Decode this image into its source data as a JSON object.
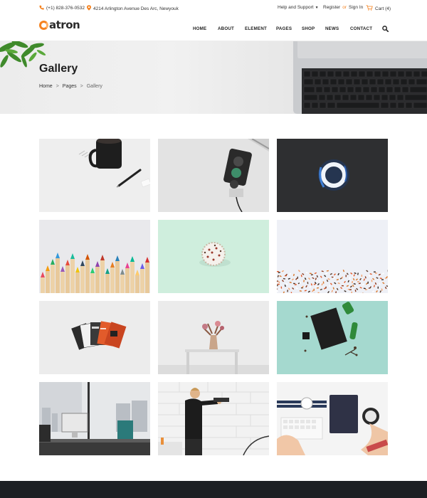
{
  "topbar": {
    "phone": "(+1) 828-376-0532",
    "address": "4214 Arlington Avenue Des Arc, Newyouk",
    "help": "Help and Support",
    "register": "Register",
    "or": "or",
    "signin": "Sign In",
    "cart": "Cart (4)"
  },
  "header": {
    "logo_text": "atron",
    "nav": [
      "HOME",
      "ABOUT",
      "ELEMENT",
      "PAGES",
      "SHOP",
      "NEWS",
      "CONTACT"
    ]
  },
  "banner": {
    "title": "Gallery",
    "breadcrumb": [
      "Home",
      "Pages",
      "Gallery"
    ],
    "separator": ">"
  },
  "gallery": {
    "tiles": [
      "mug-and-pen-tile",
      "traffic-light-tile",
      "ring-light-tile",
      "colored-pencils-tile",
      "cupcake-tile",
      "sprinkles-tile",
      "cards-tile",
      "flower-table-tile",
      "desk-flatlay-tile",
      "office-desk-tile",
      "man-wall-tile",
      "workspace-tile"
    ]
  },
  "colors": {
    "accent": "#f5821f",
    "footer": "#1c1f23"
  }
}
